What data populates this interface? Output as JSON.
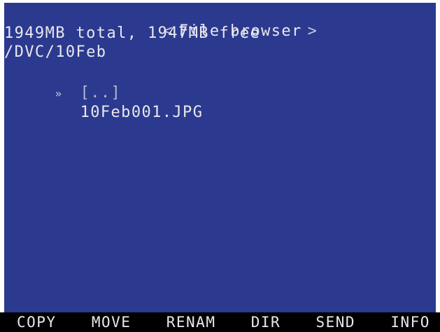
{
  "header": {
    "title": "File browser",
    "prev_glyph": "<",
    "next_glyph": ">"
  },
  "storage": {
    "summary": "1949MB total, 1947MB free"
  },
  "path": {
    "current": "/DVC/10Feb"
  },
  "file_list": {
    "cursor_glyph": "»",
    "items": [
      {
        "name": "[..]",
        "selected": true
      },
      {
        "name": "10Feb001.JPG",
        "selected": false
      }
    ]
  },
  "softkeys": {
    "copy": "COPY",
    "move": "MOVE",
    "rename": "RENAM",
    "dir": "DIR",
    "send": "SEND",
    "info": "INFO"
  }
}
